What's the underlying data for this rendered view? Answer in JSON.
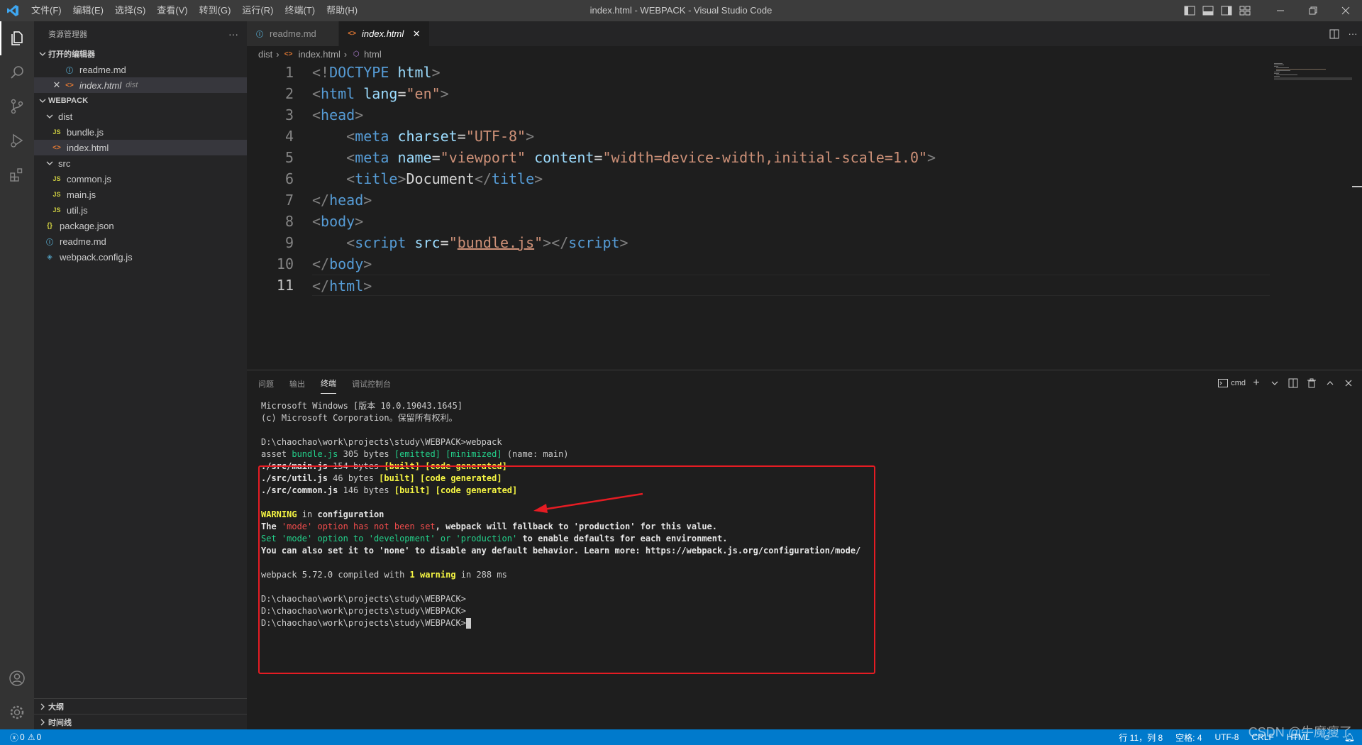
{
  "titlebar": {
    "menu": [
      "文件(F)",
      "编辑(E)",
      "选择(S)",
      "查看(V)",
      "转到(G)",
      "运行(R)",
      "终端(T)",
      "帮助(H)"
    ],
    "window_title": "index.html - WEBPACK - Visual Studio Code"
  },
  "sidebar": {
    "title": "资源管理器",
    "more": "···",
    "open_editors_label": "打开的编辑器",
    "open_editors": [
      {
        "name": "readme.md",
        "dir": ""
      },
      {
        "name": "index.html",
        "dir": "dist"
      }
    ],
    "workspace_label": "WEBPACK",
    "tree": {
      "dist": "dist",
      "bundle": "bundle.js",
      "index": "index.html",
      "src": "src",
      "common": "common.js",
      "main": "main.js",
      "util": "util.js",
      "package": "package.json",
      "readme": "readme.md",
      "webpack_config": "webpack.config.js"
    },
    "outline_label": "大纲",
    "timeline_label": "时间线"
  },
  "tabs": [
    {
      "label": "readme.md"
    },
    {
      "label": "index.html"
    }
  ],
  "breadcrumb": [
    "dist",
    "index.html",
    "html"
  ],
  "editor": {
    "line_numbers": [
      "1",
      "2",
      "3",
      "4",
      "5",
      "6",
      "7",
      "8",
      "9",
      "10",
      "11"
    ]
  },
  "panel": {
    "tabs": [
      "问题",
      "输出",
      "终端",
      "调试控制台"
    ],
    "shell": "cmd"
  },
  "terminal": {
    "l1": "Microsoft Windows [版本 10.0.19043.1645]",
    "l2": "(c) Microsoft Corporation。保留所有权利。",
    "prompt_webpack": "D:\\chaochao\\work\\projects\\study\\WEBPACK>webpack",
    "prompt": "D:\\chaochao\\work\\projects\\study\\WEBPACK>"
  },
  "statusbar": {
    "errors": "0",
    "warnings": "0",
    "position": "行 11，列 8",
    "spaces": "空格: 4",
    "encoding": "UTF-8",
    "eol": "CRLF",
    "language": "HTML"
  },
  "watermark": "CSDN @牛魔瘦了"
}
